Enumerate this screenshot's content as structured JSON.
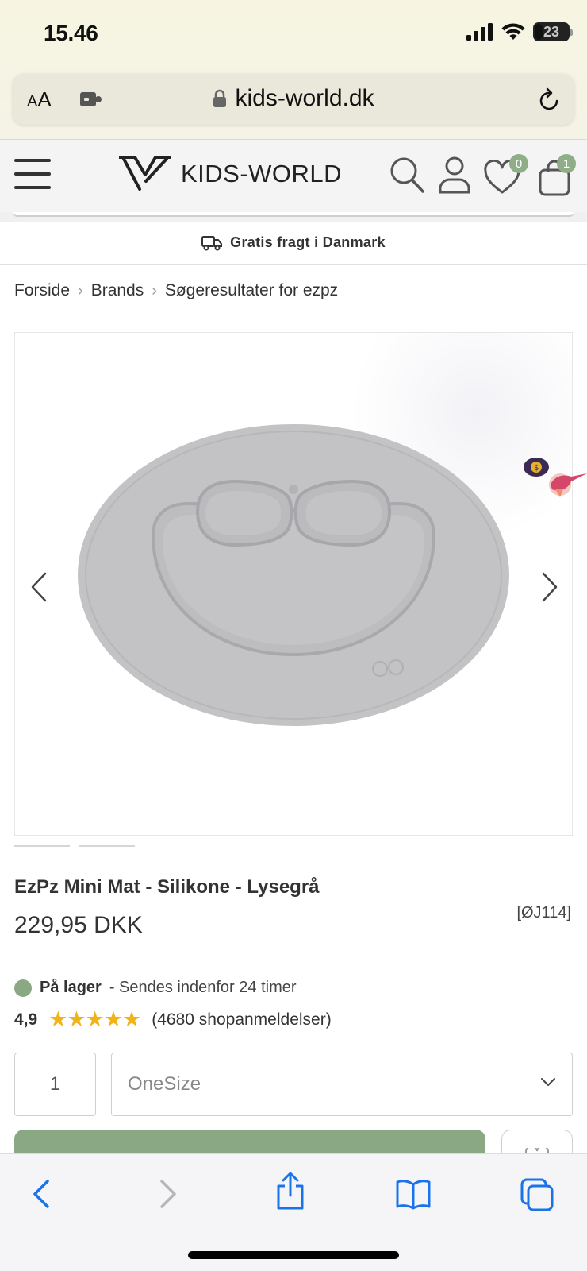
{
  "status_bar": {
    "time": "15.46",
    "battery_level": "23",
    "battery_fraction": 0.23
  },
  "browser": {
    "text_size_button": {
      "small": "A",
      "large": "A"
    },
    "url": "kids-world.dk"
  },
  "header": {
    "logo_text": "KIDS-WORLD",
    "wishlist_count": "0",
    "cart_count": "1"
  },
  "banner": {
    "shipping_text": "Gratis fragt i Danmark"
  },
  "breadcrumb": {
    "items": [
      "Forside",
      "Brands",
      "Søgeresultater for ezpz"
    ]
  },
  "product": {
    "title": "EzPz Mini Mat - Silikone - Lysegrå",
    "price": "229,95 DKK",
    "sku": "[ØJ114]",
    "stock_label": "På lager",
    "stock_note": "- Sendes indenfor 24 timer",
    "rating": "4,9",
    "stars": "★★★★★",
    "rating_count": "(4680 shopanmeldelser)",
    "quantity": "1",
    "size": "OneSize"
  },
  "colors": {
    "accent_green": "#8aa884",
    "badge_green": "#8fae88",
    "star_yellow": "#f2b318",
    "ios_blue": "#1a73e8"
  },
  "icons": {
    "status": [
      "signal-icon",
      "wifi-icon",
      "battery-icon"
    ],
    "browser": [
      "text-size-icon",
      "extension-icon",
      "lock-icon",
      "reload-icon"
    ],
    "header": [
      "menu-icon",
      "search-icon",
      "account-icon",
      "heart-icon",
      "bag-icon"
    ],
    "toolbar": [
      "back-icon",
      "forward-icon",
      "share-icon",
      "bookmarks-icon",
      "tabs-icon"
    ]
  }
}
